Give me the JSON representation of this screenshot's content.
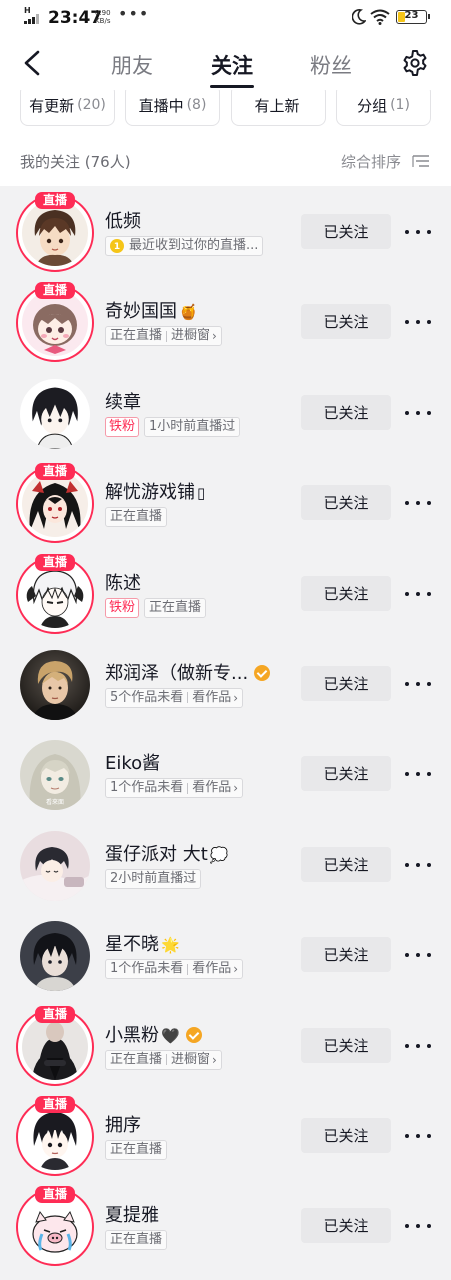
{
  "status_bar": {
    "network": "H",
    "time": "23:47",
    "speed_value": "0.90",
    "speed_unit": "KB/s",
    "dots": "•••",
    "battery": "23",
    "battery_color": "#f5c518"
  },
  "header": {
    "tabs": [
      {
        "label": "朋友",
        "active": false
      },
      {
        "label": "关注",
        "active": true
      },
      {
        "label": "粉丝",
        "active": false
      }
    ]
  },
  "filters": [
    {
      "label": "有更新",
      "count": "(20)"
    },
    {
      "label": "直播中",
      "count": "(8)"
    },
    {
      "label": "有上新",
      "count": ""
    },
    {
      "label": "分组",
      "count": "(1)"
    }
  ],
  "section": {
    "title": "我的关注 (76人)",
    "sort_label": "综合排序"
  },
  "follow_label": "已关注",
  "live_label": "直播",
  "accent_color": "#fe2c55",
  "users": [
    {
      "name": "低频",
      "live": true,
      "avatar": "boy-brown",
      "subtitle": {
        "coin": true,
        "text": "最近收到过你的直播...",
        "parts": []
      }
    },
    {
      "name": "奇妙国国",
      "emoji": "🍯",
      "live": true,
      "avatar": "chibi",
      "subtitle": {
        "parts": [
          "正在直播",
          "进橱窗"
        ],
        "arrow": true
      }
    },
    {
      "name": "续章",
      "live": false,
      "avatar": "dark-boy",
      "fan_tag": "铁粉",
      "subtitle": {
        "parts": [
          "1小时前直播过"
        ]
      }
    },
    {
      "name": "解忧游戏铺",
      "emoji": "▯",
      "live": true,
      "avatar": "red-girl",
      "subtitle": {
        "parts": [
          "正在直播"
        ]
      }
    },
    {
      "name": "陈述",
      "live": true,
      "avatar": "white-hair",
      "fan_tag": "铁粉",
      "subtitle": {
        "parts": [
          "正在直播"
        ]
      }
    },
    {
      "name": "郑润泽（做新专...",
      "verified": true,
      "live": false,
      "avatar": "photo-man",
      "subtitle": {
        "parts": [
          "5个作品未看",
          "看作品"
        ],
        "arrow": true
      }
    },
    {
      "name": "Eiko酱",
      "live": false,
      "avatar": "pale-girl",
      "subtitle": {
        "parts": [
          "1个作品未看",
          "看作品"
        ],
        "arrow": true
      }
    },
    {
      "name": "蛋仔派对 大t",
      "emoji": "💭",
      "live": false,
      "avatar": "sleeping-boy",
      "subtitle": {
        "parts": [
          "2小时前直播过"
        ]
      }
    },
    {
      "name": "星不晓",
      "emoji": "🌟",
      "live": false,
      "avatar": "black-hair",
      "subtitle": {
        "parts": [
          "1个作品未看",
          "看作品"
        ],
        "arrow": true
      }
    },
    {
      "name": "小黑粉",
      "emoji": "🖤",
      "verified": true,
      "live": true,
      "avatar": "black-coat",
      "subtitle": {
        "parts": [
          "正在直播",
          "进橱窗"
        ],
        "arrow": true
      }
    },
    {
      "name": "拥序",
      "live": true,
      "avatar": "anime-boy",
      "subtitle": {
        "parts": [
          "正在直播"
        ]
      }
    },
    {
      "name": "夏提雅",
      "live": true,
      "avatar": "cartoon-pig",
      "subtitle": {
        "parts": [
          "正在直播"
        ]
      }
    }
  ]
}
